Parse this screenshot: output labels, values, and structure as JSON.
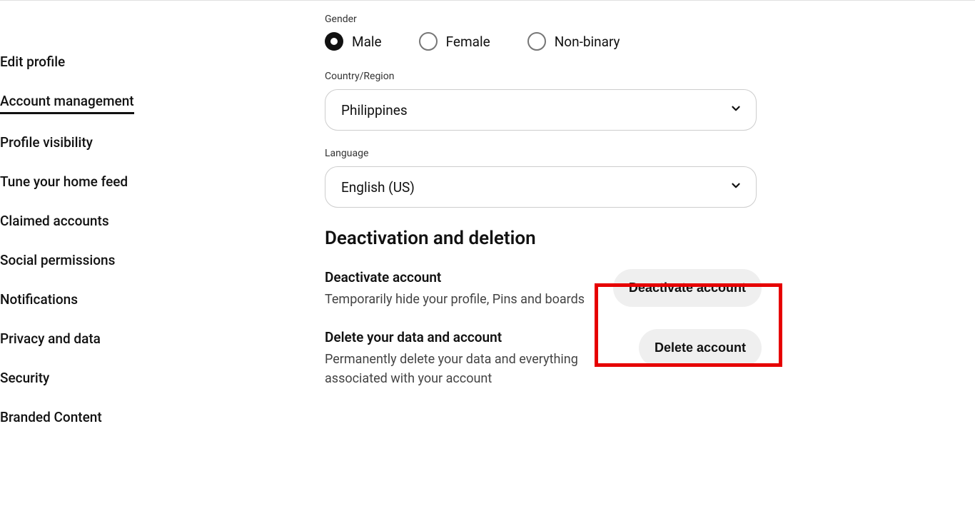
{
  "sidebar": {
    "items": [
      {
        "label": "Edit profile",
        "active": false
      },
      {
        "label": "Account management",
        "active": true
      },
      {
        "label": "Profile visibility",
        "active": false
      },
      {
        "label": "Tune your home feed",
        "active": false
      },
      {
        "label": "Claimed accounts",
        "active": false
      },
      {
        "label": "Social permissions",
        "active": false
      },
      {
        "label": "Notifications",
        "active": false
      },
      {
        "label": "Privacy and data",
        "active": false
      },
      {
        "label": "Security",
        "active": false
      },
      {
        "label": "Branded Content",
        "active": false
      }
    ]
  },
  "gender": {
    "label": "Gender",
    "options": [
      {
        "label": "Male",
        "selected": true
      },
      {
        "label": "Female",
        "selected": false
      },
      {
        "label": "Non-binary",
        "selected": false
      }
    ]
  },
  "country": {
    "label": "Country/Region",
    "value": "Philippines"
  },
  "language": {
    "label": "Language",
    "value": "English (US)"
  },
  "section": {
    "title": "Deactivation and deletion",
    "deactivate": {
      "title": "Deactivate account",
      "desc": "Temporarily hide your profile, Pins and boards",
      "button": "Deactivate account"
    },
    "delete": {
      "title": "Delete your data and account",
      "desc": "Permanently delete your data and everything associated with your account",
      "button": "Delete account"
    }
  }
}
